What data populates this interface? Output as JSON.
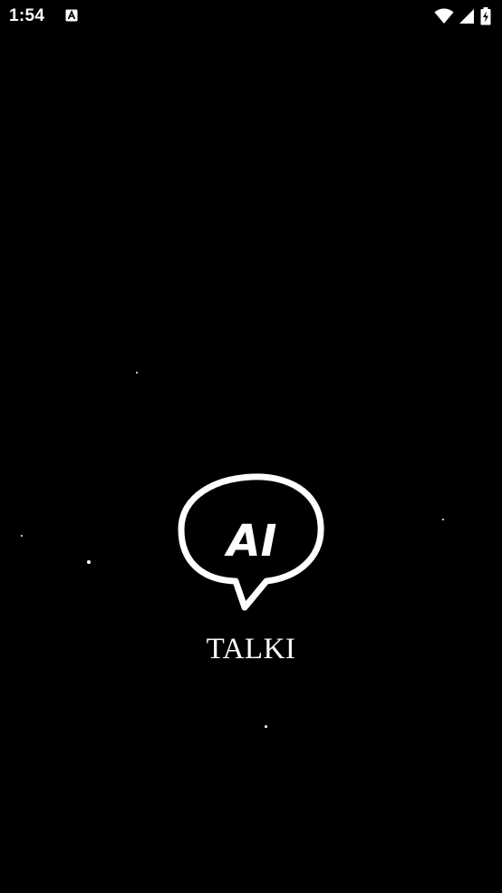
{
  "status_bar": {
    "time": "1:54",
    "notification_icon": "a-box-icon",
    "icons": [
      "wifi-icon",
      "signal-icon",
      "battery-charging-icon"
    ]
  },
  "splash": {
    "logo_icon": "speech-bubble-icon",
    "logo_text": "AI",
    "app_name": "TALKI"
  },
  "colors": {
    "background": "#000000",
    "foreground": "#ffffff"
  }
}
